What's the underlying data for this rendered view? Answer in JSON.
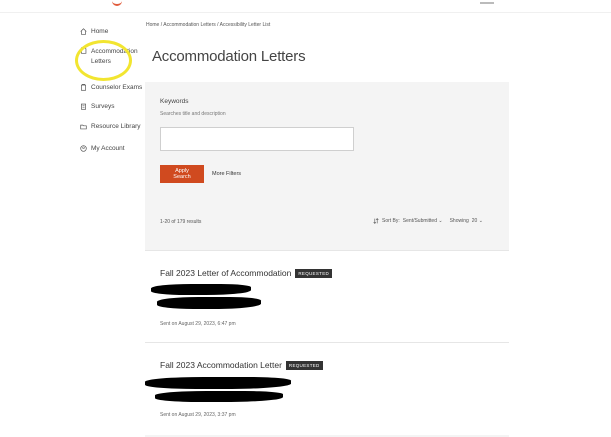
{
  "sidebar": {
    "items": [
      {
        "label": "Home",
        "icon": "home-icon"
      },
      {
        "label": "Accommodation Letters",
        "icon": "document-icon"
      },
      {
        "label": "Counselor Exams",
        "icon": "exam-icon"
      },
      {
        "label": "Surveys",
        "icon": "clipboard-icon"
      },
      {
        "label": "Resource Library",
        "icon": "folder-icon"
      },
      {
        "label": "My Account",
        "icon": "user-icon"
      }
    ]
  },
  "breadcrumb": "Home / Accommodation Letters / Accessibility Letter List",
  "page_title": "Accommodation Letters",
  "filters": {
    "keywords_label": "Keywords",
    "keywords_help": "Searches title and description",
    "keywords_value": "",
    "apply_label": "Apply Search",
    "more_filters_label": "More Filters"
  },
  "results": {
    "count_text": "1-20 of 179 results",
    "sort_label": "Sort By:",
    "sort_value": "Sent/Submitted",
    "showing_label": "Showing",
    "showing_value": "20"
  },
  "letters": [
    {
      "title": "Fall 2023 Letter of Accommodation",
      "badge": "REQUESTED",
      "sent": "Sent on August 29, 2023, 6:47 pm"
    },
    {
      "title": "Fall 2023 Accommodation Letter",
      "badge": "REQUESTED",
      "sent": "Sent on August 29, 2023, 3:37 pm"
    }
  ],
  "colors": {
    "accent": "#d04a1f",
    "highlight": "#f2e530",
    "badge_bg": "#333333"
  }
}
